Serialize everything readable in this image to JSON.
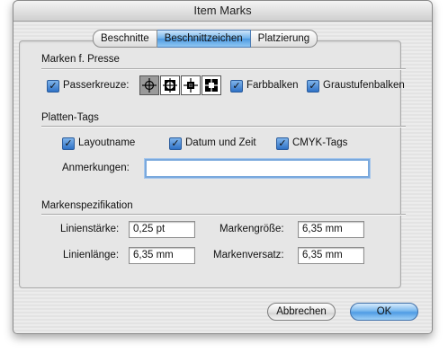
{
  "window": {
    "title": "Item Marks"
  },
  "tabs": [
    {
      "label": "Beschnitte",
      "active": false
    },
    {
      "label": "Beschnittzeichen",
      "active": true
    },
    {
      "label": "Platzierung",
      "active": false
    }
  ],
  "sections": {
    "press": {
      "title": "Marken f. Presse",
      "registration_label": "Passerkreuze:",
      "registration_checked": true,
      "registration_styles": [
        "crosshair-circle-icon",
        "registration-box-icon",
        "registration-center-icon",
        "registration-filled-icon"
      ],
      "registration_selected": 0,
      "color_bars_label": "Farbbalken",
      "color_bars_checked": true,
      "gray_bars_label": "Graustufenbalken",
      "gray_bars_checked": true
    },
    "plate_tags": {
      "title": "Platten-Tags",
      "layout_name_label": "Layoutname",
      "layout_name_checked": true,
      "date_time_label": "Datum und Zeit",
      "date_time_checked": true,
      "cmyk_tags_label": "CMYK-Tags",
      "cmyk_tags_checked": true,
      "notes_label": "Anmerkungen:",
      "notes_value": ""
    },
    "mark_spec": {
      "title": "Markenspezifikation",
      "line_weight_label": "Linienstärke:",
      "line_weight_value": "0,25 pt",
      "line_length_label": "Linienlänge:",
      "line_length_value": "6,35 mm",
      "mark_size_label": "Markengröße:",
      "mark_size_value": "6,35 mm",
      "mark_offset_label": "Markenversatz:",
      "mark_offset_value": "6,35 mm"
    }
  },
  "buttons": {
    "cancel": "Abbrechen",
    "ok": "OK"
  },
  "colors": {
    "accent": "#4d99e0",
    "window_bg": "#e9e9e9"
  }
}
